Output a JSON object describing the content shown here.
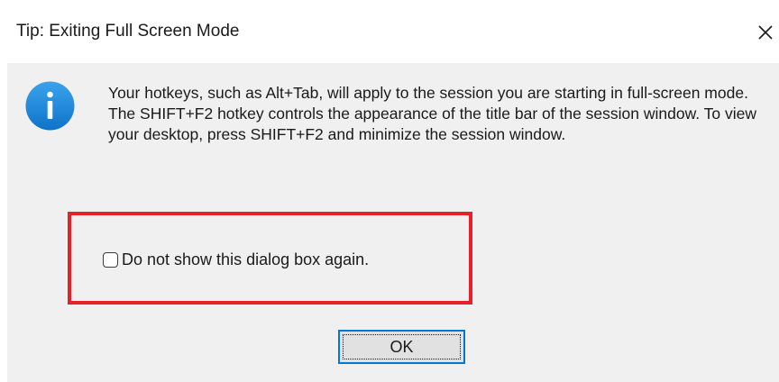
{
  "window": {
    "title": "Tip: Exiting Full Screen Mode",
    "close_glyph": "close-icon"
  },
  "message": {
    "icon": "info-icon",
    "icon_color": "#1e88d7",
    "text": "Your hotkeys, such as Alt+Tab, will apply to the session you are starting in full-screen mode. The SHIFT+F2 hotkey controls the appearance of the title bar of the session window. To view your desktop, press SHIFT+F2 and minimize the session window."
  },
  "checkbox": {
    "label": "Do not show this dialog box again.",
    "checked": false
  },
  "highlight": {
    "color": "#e8202a"
  },
  "buttons": {
    "ok_label": "OK"
  }
}
